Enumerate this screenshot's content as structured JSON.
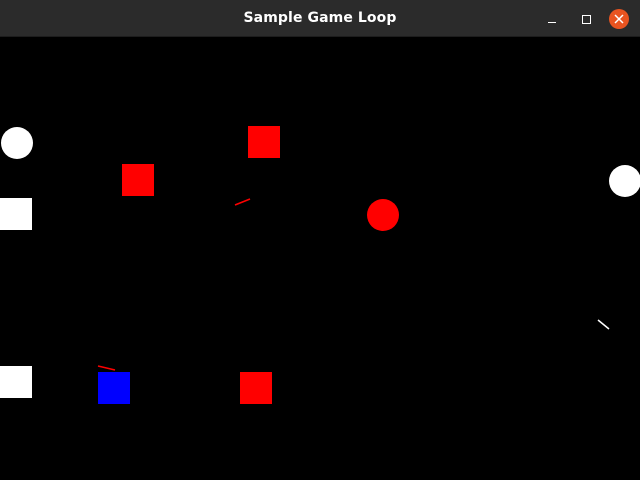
{
  "window": {
    "title": "Sample Game Loop",
    "controls": {
      "minimize_icon": "minimize-icon",
      "maximize_icon": "maximize-icon",
      "close_icon": "close-icon"
    },
    "colors": {
      "titlebar": "#2b2b2b",
      "close_button": "#e95420"
    }
  },
  "game": {
    "background": "#000000",
    "entities": [
      {
        "kind": "circle",
        "color": "#ffffff"
      },
      {
        "kind": "square",
        "color": "#ff0000"
      },
      {
        "kind": "square",
        "color": "#ff0000"
      },
      {
        "kind": "square",
        "color": "#ffffff"
      },
      {
        "kind": "circle",
        "color": "#ff0000"
      },
      {
        "kind": "circle",
        "color": "#ffffff"
      },
      {
        "kind": "projectile",
        "color": "#ff0000"
      },
      {
        "kind": "projectile",
        "color": "#ffffff"
      },
      {
        "kind": "square",
        "color": "#ffffff"
      },
      {
        "kind": "player-square",
        "color": "#0000ff"
      },
      {
        "kind": "projectile",
        "color": "#ff0000"
      },
      {
        "kind": "square",
        "color": "#ff0000"
      }
    ]
  }
}
